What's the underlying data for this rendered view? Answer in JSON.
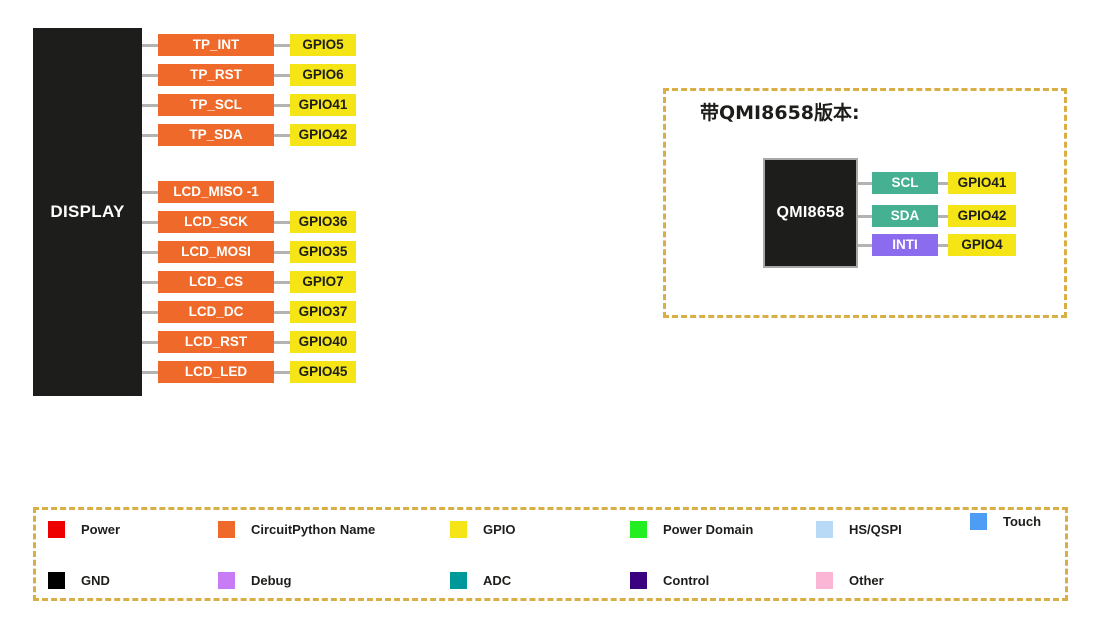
{
  "colors": {
    "chip_black": "#1d1d1b",
    "orange": "#ef6a2a",
    "yellow": "#f5e516",
    "teal_green": "#45b092",
    "purple": "#8b6cef",
    "dashed_gold": "#d8ae45",
    "lead_gray": "#b3b3b3",
    "white": "#ffffff"
  },
  "display_block": {
    "name": "DISPLAY",
    "pins": [
      {
        "label": "TP_INT",
        "gpio": "GPIO5"
      },
      {
        "label": "TP_RST",
        "gpio": "GPIO6"
      },
      {
        "label": "TP_SCL",
        "gpio": "GPIO41"
      },
      {
        "label": "TP_SDA",
        "gpio": "GPIO42"
      },
      {
        "label": "LCD_MISO -1",
        "gpio": ""
      },
      {
        "label": "LCD_SCK",
        "gpio": "GPIO36"
      },
      {
        "label": "LCD_MOSI",
        "gpio": "GPIO35"
      },
      {
        "label": "LCD_CS",
        "gpio": "GPIO7"
      },
      {
        "label": "LCD_DC",
        "gpio": "GPIO37"
      },
      {
        "label": "LCD_RST",
        "gpio": "GPIO40"
      },
      {
        "label": "LCD_LED",
        "gpio": "GPIO45"
      }
    ]
  },
  "imu_panel": {
    "title": "带QMI8658版本:",
    "chip_name": "QMI8658",
    "pins": [
      {
        "label": "SCL",
        "gpio": "GPIO41",
        "color": "#45b092"
      },
      {
        "label": "SDA",
        "gpio": "GPIO42",
        "color": "#45b092"
      },
      {
        "label": "INTI",
        "gpio": "GPIO4",
        "color": "#8b6cef"
      }
    ]
  },
  "legend": {
    "row1": [
      {
        "label": "Power",
        "color": "#ee0000"
      },
      {
        "label": "CircuitPython Name",
        "color": "#ef6a2a"
      },
      {
        "label": "GPIO",
        "color": "#f5e516"
      },
      {
        "label": "Power Domain",
        "color": "#22ee22"
      },
      {
        "label": "HS/QSPI",
        "color": "#b8daf7"
      },
      {
        "label": "Touch",
        "color": "#4d9df5"
      }
    ],
    "row2": [
      {
        "label": "GND",
        "color": "#000000"
      },
      {
        "label": "Debug",
        "color": "#c77cf5"
      },
      {
        "label": "ADC",
        "color": "#009999"
      },
      {
        "label": "Control",
        "color": "#3a0080"
      },
      {
        "label": "Other",
        "color": "#fbb6d6"
      }
    ]
  }
}
